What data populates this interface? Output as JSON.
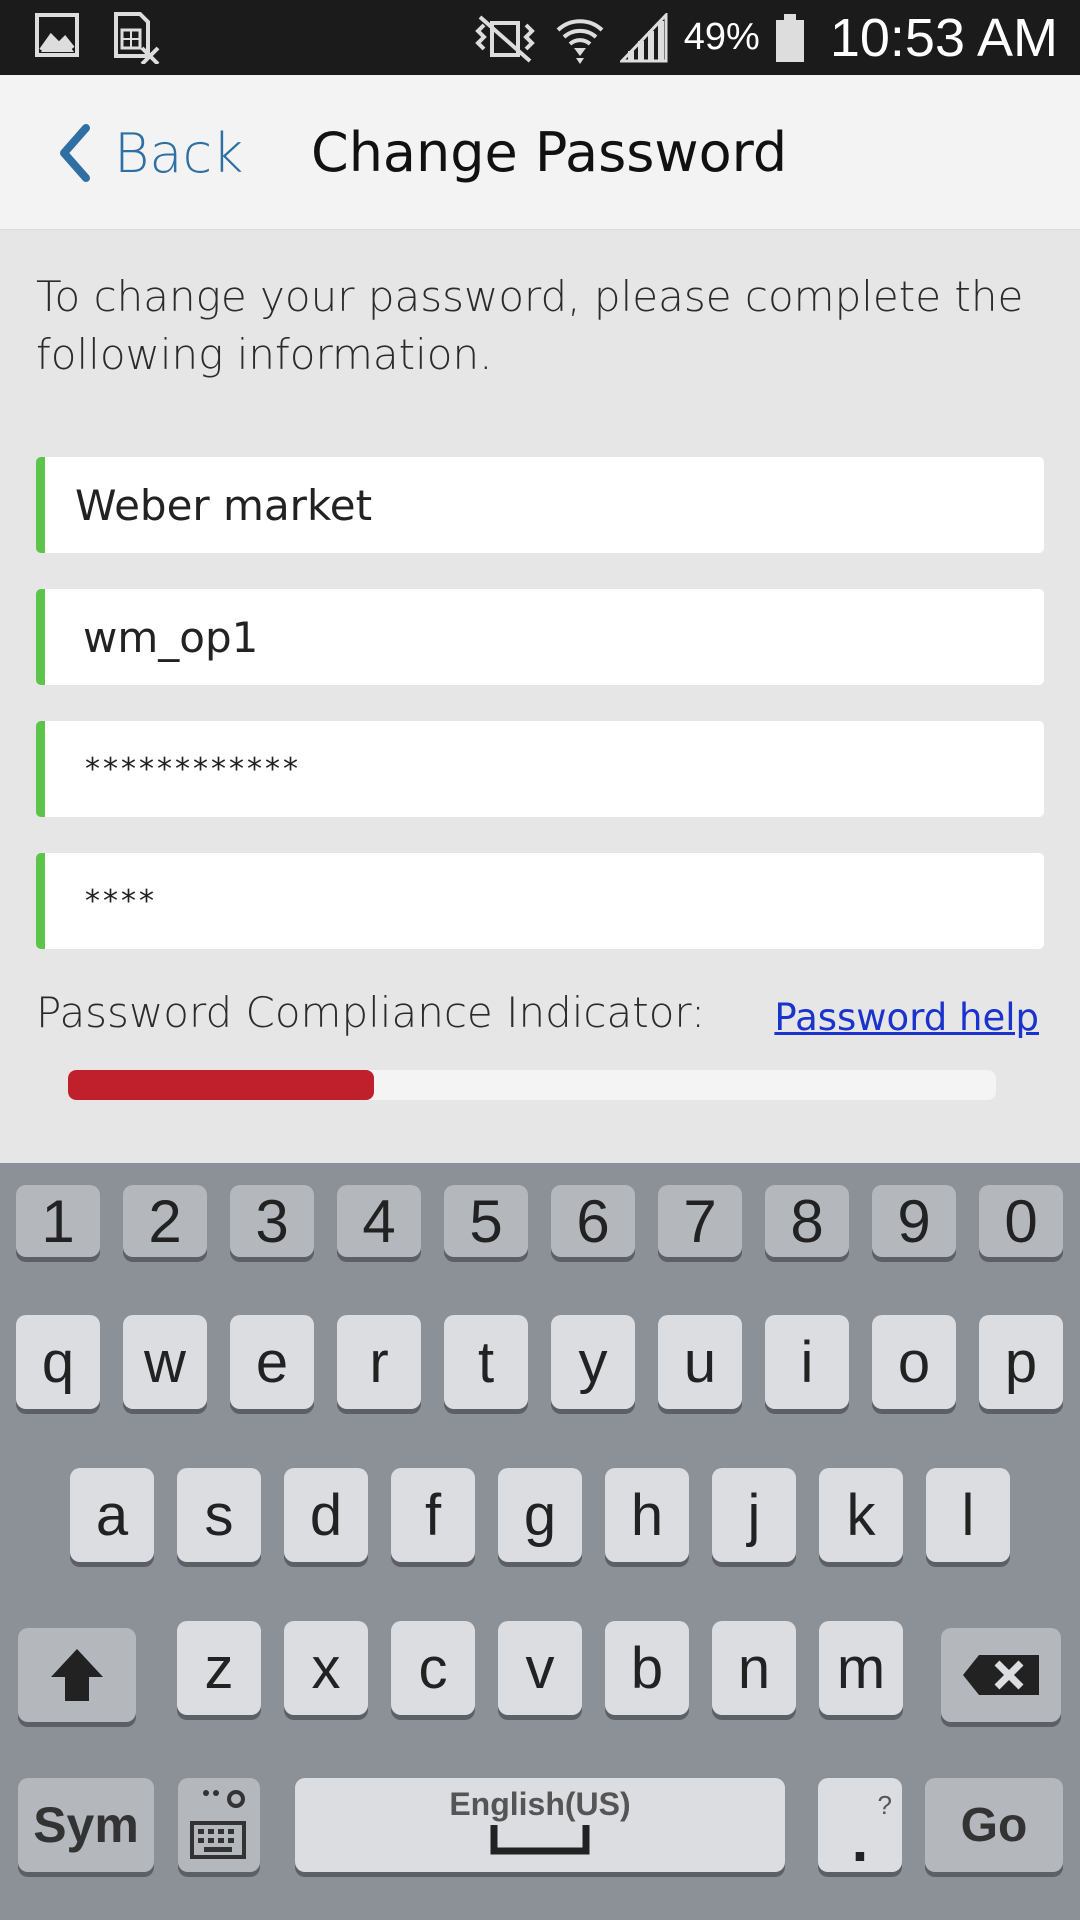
{
  "status_bar": {
    "battery_percent": "49%",
    "time": "10:53 AM",
    "icons": [
      "gallery-icon",
      "sim-blocked-icon",
      "mute-vibrate-icon",
      "wifi-icon",
      "signal-icon",
      "battery-icon"
    ]
  },
  "header": {
    "back_label": "Back",
    "title": "Change Password"
  },
  "form": {
    "instructions": "To change your password, please complete the following information.",
    "fields": [
      {
        "value": "Weber market",
        "type": "text"
      },
      {
        "value": "wm_op1",
        "type": "text"
      },
      {
        "value": "************",
        "type": "password"
      },
      {
        "value": "****",
        "type": "password"
      }
    ],
    "compliance_label": "Password Compliance Indicator:",
    "compliance_level": 0.33,
    "compliance_color": "#c0202c",
    "help_link": "Password help",
    "valid_border_color": "#5cc44a"
  },
  "keyboard": {
    "number_row": [
      "1",
      "2",
      "3",
      "4",
      "5",
      "6",
      "7",
      "8",
      "9",
      "0"
    ],
    "row1": [
      "q",
      "w",
      "e",
      "r",
      "t",
      "y",
      "u",
      "i",
      "o",
      "p"
    ],
    "row2": [
      "a",
      "s",
      "d",
      "f",
      "g",
      "h",
      "j",
      "k",
      "l"
    ],
    "row3": [
      "z",
      "x",
      "c",
      "v",
      "b",
      "n",
      "m"
    ],
    "sym_label": "Sym",
    "space_label": "English(US)",
    "period_label": ".",
    "period_hint": "?",
    "go_label": "Go",
    "icons": [
      "shift-icon",
      "backspace-icon",
      "keyboard-settings-icon",
      "space-icon"
    ]
  }
}
